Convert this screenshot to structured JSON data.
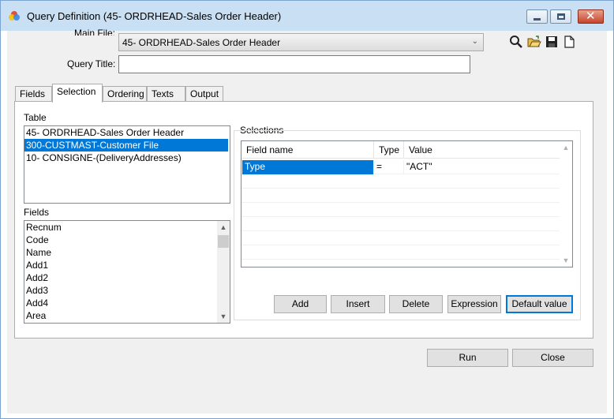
{
  "window": {
    "title": "Query Definition (45- ORDRHEAD-Sales Order Header)"
  },
  "toolbar": {
    "icons": [
      "search-icon",
      "open-folder-icon",
      "save-icon",
      "new-document-icon"
    ]
  },
  "header": {
    "main_file_label": "Main File:",
    "main_file_value": "45- ORDRHEAD-Sales Order Header",
    "query_title_label": "Query Title:",
    "query_title_value": ""
  },
  "tabs": [
    {
      "label": "Fields",
      "active": false
    },
    {
      "label": "Selection",
      "active": true
    },
    {
      "label": "Ordering",
      "active": false
    },
    {
      "label": "Texts",
      "active": false
    },
    {
      "label": "Output",
      "active": false
    }
  ],
  "selection_tab": {
    "table_label": "Table",
    "tables": [
      "45- ORDRHEAD-Sales Order Header",
      "300-CUSTMAST-Customer File",
      "10- CONSIGNE-(DeliveryAddresses)"
    ],
    "selected_table_index": 1,
    "fields_label": "Fields",
    "fields": [
      "Recnum",
      "Code",
      "Name",
      "Add1",
      "Add2",
      "Add3",
      "Add4",
      "Area"
    ],
    "selections_label": "Selections",
    "grid": {
      "columns": [
        "Field name",
        "Type",
        "Value"
      ],
      "rows": [
        {
          "field": "Type",
          "type": "=",
          "value": "\"ACT\""
        }
      ]
    },
    "buttons": {
      "add": "Add",
      "insert": "Insert",
      "delete": "Delete",
      "expression": "Expression",
      "default_value": "Default value"
    }
  },
  "footer": {
    "run": "Run",
    "close": "Close"
  },
  "colors": {
    "selection": "#0078d7",
    "titlebar": "#c9dff3"
  }
}
